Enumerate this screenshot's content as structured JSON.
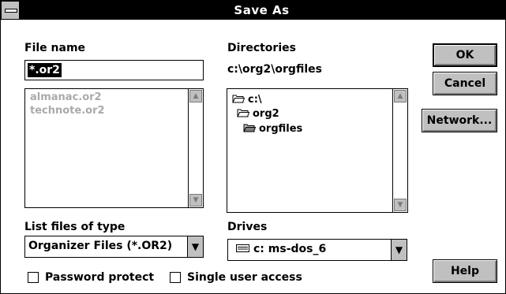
{
  "window": {
    "title": "Save As"
  },
  "file_name": {
    "label": "File name",
    "value": "*.or2",
    "list": [
      "almanac.or2",
      "technote.or2"
    ]
  },
  "directories": {
    "label": "Directories",
    "current_path": "c:\\org2\\orgfiles",
    "tree": [
      {
        "name": "c:\\",
        "icon": "open-folder-icon"
      },
      {
        "name": "org2",
        "icon": "open-folder-icon"
      },
      {
        "name": "orgfiles",
        "icon": "open-folder-selected-icon"
      }
    ]
  },
  "file_type": {
    "label": "List files of type",
    "selected": "Organizer Files (*.OR2)"
  },
  "drives": {
    "label": "Drives",
    "selected": "c: ms-dos_6",
    "icon": "drive-icon"
  },
  "buttons": {
    "ok": "OK",
    "cancel": "Cancel",
    "network": "Network...",
    "help": "Help"
  },
  "options": {
    "password_protect": {
      "label": "Password protect",
      "checked": false
    },
    "single_user_access": {
      "label": "Single user access",
      "checked": false
    }
  }
}
